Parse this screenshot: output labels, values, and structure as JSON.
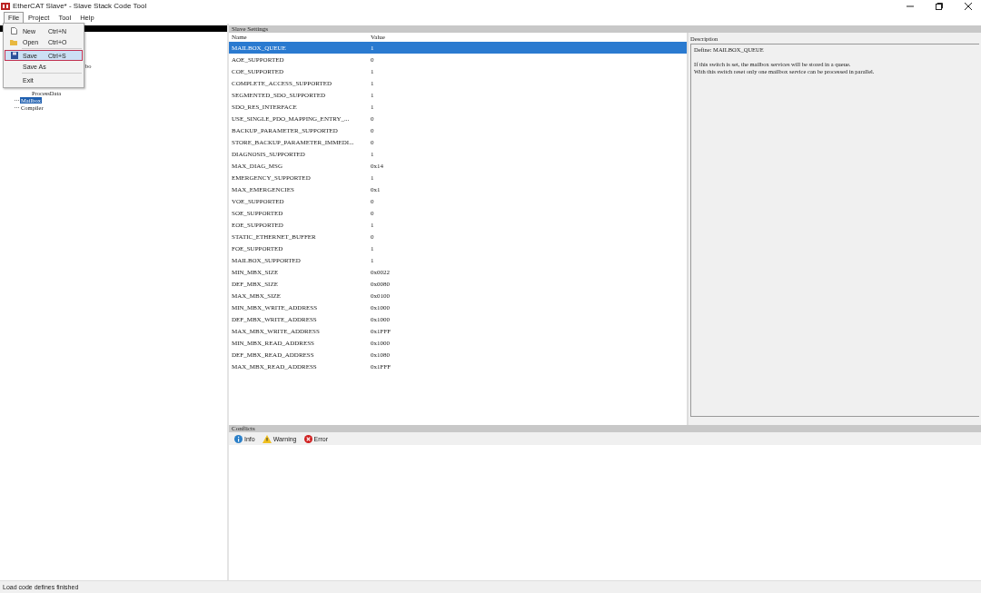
{
  "window": {
    "title": "EtherCAT Slave* - Slave Stack Code Tool"
  },
  "menu_bar": [
    {
      "label": "File",
      "selected": true
    },
    {
      "label": "Project",
      "selected": false
    },
    {
      "label": "Tool",
      "selected": false
    },
    {
      "label": "Help",
      "selected": false
    }
  ],
  "file_menu": [
    {
      "kind": "new",
      "label": "New",
      "shortcut": "Ctrl+N",
      "selected": false
    },
    {
      "kind": "open",
      "label": "Open",
      "shortcut": "Ctrl+O",
      "selected": false
    },
    {
      "kind": "separator"
    },
    {
      "kind": "save",
      "label": "Save",
      "shortcut": "Ctrl+S",
      "selected": true
    },
    {
      "kind": "plain",
      "label": "Save As",
      "selected": false
    },
    {
      "kind": "separator"
    },
    {
      "kind": "plain",
      "label": "Exit",
      "selected": false
    }
  ],
  "tree": [
    {
      "label": "bo",
      "selected": false,
      "children": [
        {
          "label": "ProcessData",
          "selected": false
        }
      ]
    },
    {
      "label": "Mailbox",
      "selected": true
    },
    {
      "label": "Compiler",
      "selected": false
    }
  ],
  "settings": {
    "title": "Slave Settings",
    "columns": [
      "Name",
      "Value"
    ],
    "rows": [
      {
        "name": "MAILBOX_QUEUE",
        "value": "1",
        "selected": true
      },
      {
        "name": "AOE_SUPPORTED",
        "value": "0",
        "selected": false
      },
      {
        "name": "COE_SUPPORTED",
        "value": "1",
        "selected": false
      },
      {
        "name": "COMPLETE_ACCESS_SUPPORTED",
        "value": "1",
        "selected": false
      },
      {
        "name": "SEGMENTED_SDO_SUPPORTED",
        "value": "1",
        "selected": false
      },
      {
        "name": "SDO_RES_INTERFACE",
        "value": "1",
        "selected": false
      },
      {
        "name": "USE_SINGLE_PDO_MAPPING_ENTRY_...",
        "value": "0",
        "selected": false
      },
      {
        "name": "BACKUP_PARAMETER_SUPPORTED",
        "value": "0",
        "selected": false
      },
      {
        "name": "STORE_BACKUP_PARAMETER_IMMEDI...",
        "value": "0",
        "selected": false
      },
      {
        "name": "DIAGNOSIS_SUPPORTED",
        "value": "1",
        "selected": false
      },
      {
        "name": "MAX_DIAG_MSG",
        "value": "0x14",
        "selected": false
      },
      {
        "name": "EMERGENCY_SUPPORTED",
        "value": "1",
        "selected": false
      },
      {
        "name": "MAX_EMERGENCIES",
        "value": "0x1",
        "selected": false
      },
      {
        "name": "VOE_SUPPORTED",
        "value": "0",
        "selected": false
      },
      {
        "name": "SOE_SUPPORTED",
        "value": "0",
        "selected": false
      },
      {
        "name": "EOE_SUPPORTED",
        "value": "1",
        "selected": false
      },
      {
        "name": "STATIC_ETHERNET_BUFFER",
        "value": "0",
        "selected": false
      },
      {
        "name": "FOE_SUPPORTED",
        "value": "1",
        "selected": false
      },
      {
        "name": "MAILBOX_SUPPORTED",
        "value": "1",
        "selected": false
      },
      {
        "name": "MIN_MBX_SIZE",
        "value": "0x0022",
        "selected": false
      },
      {
        "name": "DEF_MBX_SIZE",
        "value": "0x0080",
        "selected": false
      },
      {
        "name": "MAX_MBX_SIZE",
        "value": "0x0100",
        "selected": false
      },
      {
        "name": "MIN_MBX_WRITE_ADDRESS",
        "value": "0x1000",
        "selected": false
      },
      {
        "name": "DEF_MBX_WRITE_ADDRESS",
        "value": "0x1000",
        "selected": false
      },
      {
        "name": "MAX_MBX_WRITE_ADDRESS",
        "value": "0x1FFF",
        "selected": false
      },
      {
        "name": "MIN_MBX_READ_ADDRESS",
        "value": "0x1000",
        "selected": false
      },
      {
        "name": "DEF_MBX_READ_ADDRESS",
        "value": "0x1080",
        "selected": false
      },
      {
        "name": "MAX_MBX_READ_ADDRESS",
        "value": "0x1FFF",
        "selected": false
      }
    ]
  },
  "description": {
    "title": "Description",
    "lines": [
      "Define: MAILBOX_QUEUE",
      "If this switch is set, the mailbox services will be stored in a queue.",
      "With this switch reset only one mailbox service can be processed in parallel."
    ]
  },
  "conflicts": {
    "title": "Conflicts",
    "filters": [
      {
        "kind": "info",
        "label": "Info"
      },
      {
        "kind": "warning",
        "label": "Warning"
      },
      {
        "kind": "error",
        "label": "Error"
      }
    ]
  },
  "status_bar": "Load code defines finished"
}
